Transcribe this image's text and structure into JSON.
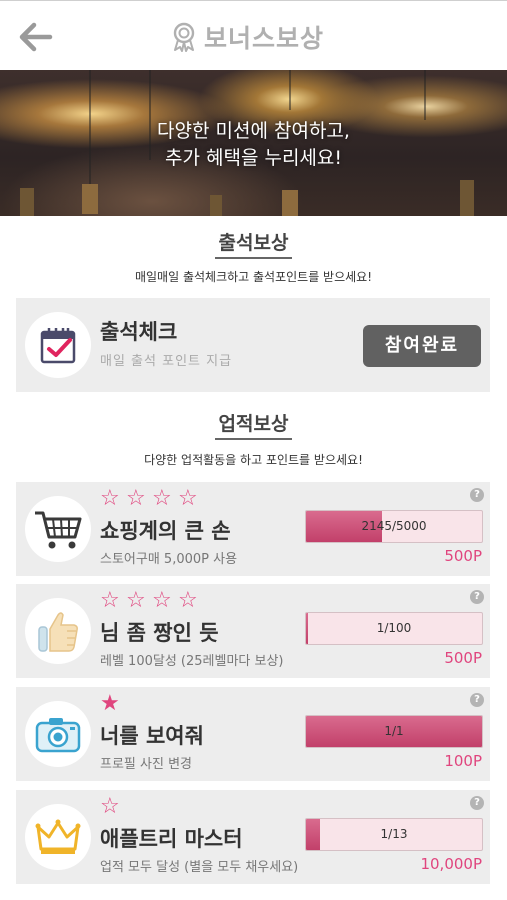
{
  "header": {
    "title": "보너스보상",
    "back_icon": "back-arrow-icon",
    "title_icon": "ribbon-badge-icon"
  },
  "banner": {
    "line1": "다양한 미션에 참여하고,",
    "line2": "추가 혜택을 누리세요!"
  },
  "attendance_section": {
    "title": "출석보상",
    "subtitle": "매일매일 출석체크하고 출석포인트를 받으세요!",
    "card": {
      "title": "출석체크",
      "subtitle": "매일 출석 포인트 지급",
      "button_label": "참여완료",
      "icon": "calendar-check-icon"
    }
  },
  "achievement_section": {
    "title": "업적보상",
    "subtitle": "다양한 업적활동을 하고 포인트를 받으세요!",
    "items": [
      {
        "title": "쇼핑계의 큰 손",
        "subtitle": "스토어구매 5,000P 사용",
        "progress_label": "2145/5000",
        "progress": 0.429,
        "points": "500P",
        "stars_filled": 0,
        "stars_total": 4,
        "help": "?",
        "icon": "shopping-cart-icon"
      },
      {
        "title": "님 좀 짱인 듯",
        "subtitle": "레벨 100달성 (25레벨마다 보상)",
        "progress_label": "1/100",
        "progress": 0.01,
        "points": "500P",
        "stars_filled": 0,
        "stars_total": 4,
        "help": "?",
        "icon": "thumbs-up-icon"
      },
      {
        "title": "너를 보여줘",
        "subtitle": "프로필 사진 변경",
        "progress_label": "1/1",
        "progress": 1.0,
        "points": "100P",
        "stars_filled": 1,
        "stars_total": 1,
        "help": "?",
        "icon": "camera-icon"
      },
      {
        "title": "애플트리 마스터",
        "subtitle": "업적 모두 달성 (별을 모두 채우세요)",
        "progress_label": "1/13",
        "progress": 0.077,
        "points": "10,000P",
        "stars_filled": 0,
        "stars_total": 1,
        "help": "?",
        "icon": "crown-icon"
      }
    ]
  },
  "colors": {
    "accent": "#e0457e",
    "progress_fill": "#c9496f",
    "progress_bg": "#f9e4e9",
    "card_bg": "#ededed",
    "button_bg": "#616161"
  }
}
